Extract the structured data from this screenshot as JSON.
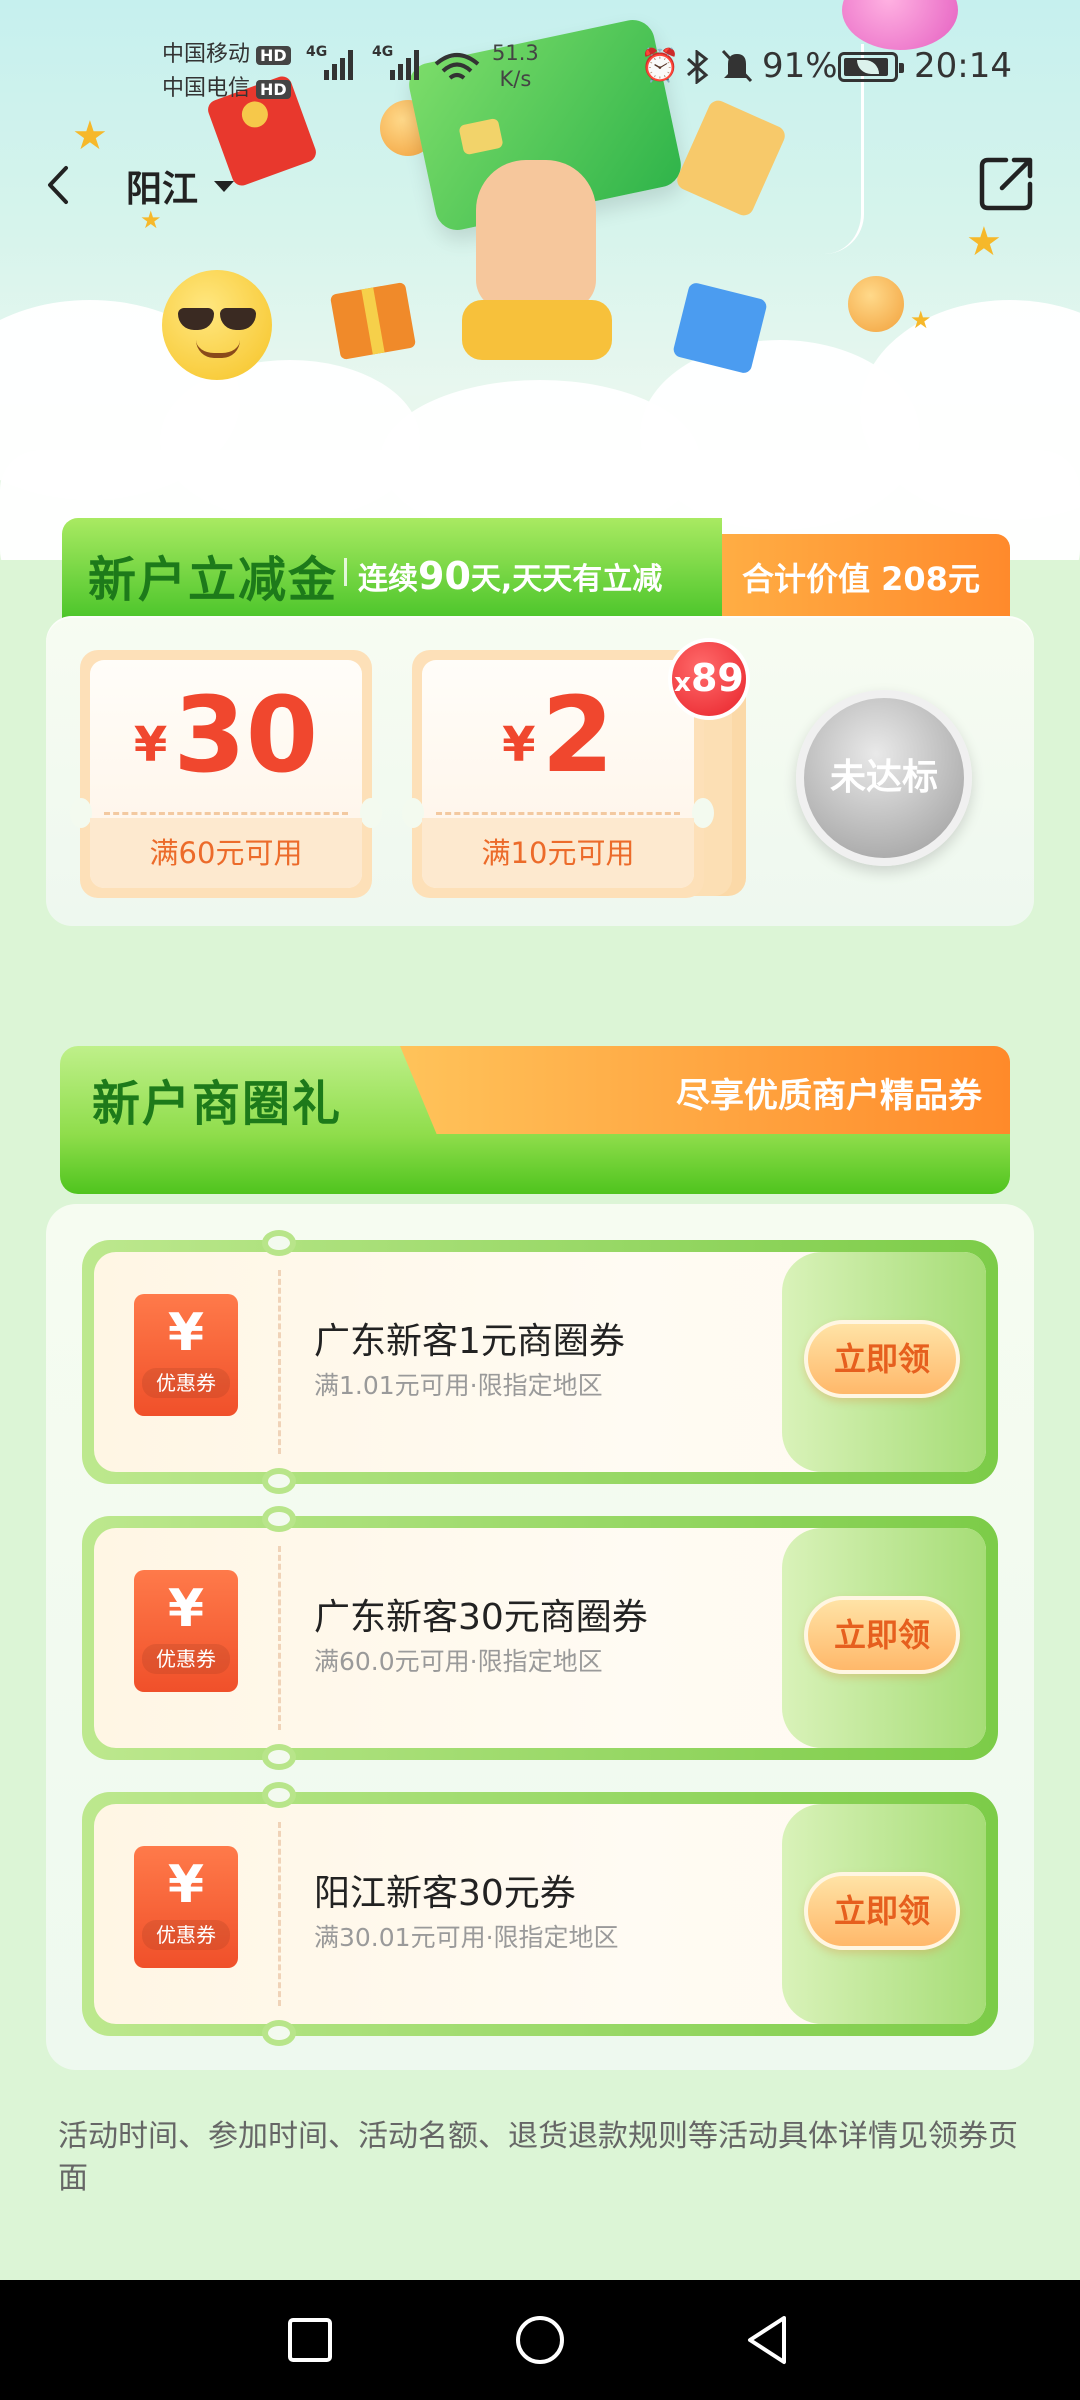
{
  "status_bar": {
    "carrier_1": "中国移动",
    "carrier_2": "中国电信",
    "hd": "HD",
    "network_1": "4G",
    "network_2": "4G",
    "speed_value": "51.3",
    "speed_unit": "K/s",
    "battery": "91%",
    "time": "20:14"
  },
  "nav": {
    "city": "阳江"
  },
  "new_user_discount": {
    "title": "新户立减金",
    "subtitle_prefix": "连续",
    "subtitle_days": "90",
    "subtitle_suffix": "天,天天有立减",
    "total": "合计价值 208元",
    "coupons": [
      {
        "currency": "¥",
        "amount": "30",
        "condition": "满60元可用"
      },
      {
        "currency": "¥",
        "amount": "2",
        "condition": "满10元可用"
      }
    ],
    "stack_count_prefix": "x",
    "stack_count": "89",
    "status_button": "未达标"
  },
  "business_gift": {
    "title": "新户商圈礼",
    "subtitle": "尽享优质商户精品券",
    "coupons": [
      {
        "tag_symbol": "¥",
        "tag_label": "优惠券",
        "name": "广东新客1元商圈券",
        "desc": "满1.01元可用·限指定地区",
        "action": "立即领"
      },
      {
        "tag_symbol": "¥",
        "tag_label": "优惠券",
        "name": "广东新客30元商圈券",
        "desc": "满60.0元可用·限指定地区",
        "action": "立即领"
      },
      {
        "tag_symbol": "¥",
        "tag_label": "优惠券",
        "name": "阳江新客30元券",
        "desc": "满30.01元可用·限指定地区",
        "action": "立即领"
      }
    ]
  },
  "footnote": "活动时间、参加时间、活动名额、退货退款规则等活动具体详情见领券页面",
  "icons": [
    "back-arrow-icon",
    "dropdown-caret-icon",
    "share-icon",
    "alarm-icon",
    "bluetooth-icon",
    "mute-icon",
    "wifi-icon",
    "signal-icon",
    "battery-icon",
    "recent-apps-icon",
    "home-icon",
    "back-icon"
  ],
  "colors": {
    "accent_green": "#4bc52a",
    "accent_orange": "#ff8a2c",
    "price_red": "#f0472e",
    "title_green": "#1d7a1a"
  }
}
